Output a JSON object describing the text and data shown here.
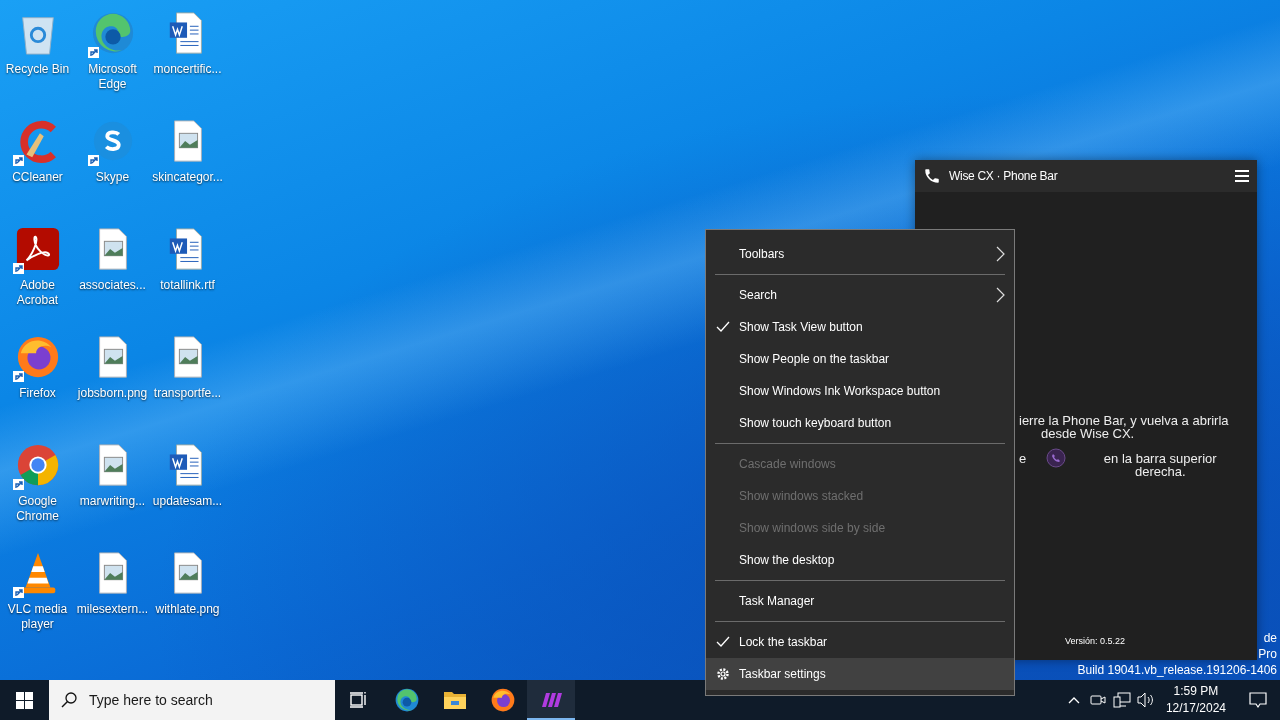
{
  "desktop": {
    "icons": [
      {
        "label": "Recycle Bin",
        "kind": "recycle",
        "shortcut": false
      },
      {
        "label": "CCleaner",
        "kind": "ccleaner",
        "shortcut": true
      },
      {
        "label": "Adobe Acrobat",
        "kind": "acrobat",
        "shortcut": true
      },
      {
        "label": "Firefox",
        "kind": "firefox",
        "shortcut": true
      },
      {
        "label": "Google Chrome",
        "kind": "chrome",
        "shortcut": true
      },
      {
        "label": "VLC media player",
        "kind": "vlc",
        "shortcut": true
      },
      {
        "label": "Microsoft Edge",
        "kind": "edge",
        "shortcut": true
      },
      {
        "label": "Skype",
        "kind": "skype",
        "shortcut": true
      },
      {
        "label": "associates...",
        "kind": "image",
        "shortcut": false
      },
      {
        "label": "jobsborn.png",
        "kind": "image",
        "shortcut": false
      },
      {
        "label": "marwriting...",
        "kind": "image",
        "shortcut": false
      },
      {
        "label": "milesextern...",
        "kind": "image",
        "shortcut": false
      },
      {
        "label": "moncertific...",
        "kind": "word",
        "shortcut": false
      },
      {
        "label": "skincategor...",
        "kind": "image",
        "shortcut": false
      },
      {
        "label": "totallink.rtf",
        "kind": "word",
        "shortcut": false
      },
      {
        "label": "transportfe...",
        "kind": "image",
        "shortcut": false
      },
      {
        "label": "updatesam...",
        "kind": "word",
        "shortcut": false
      },
      {
        "label": "withlate.png",
        "kind": "image",
        "shortcut": false
      }
    ],
    "os_watermark": [
      "de",
      "Pro",
      "Build 19041.vb_release.191206-1406"
    ]
  },
  "phone_bar": {
    "title": "Wise CX · Phone Bar",
    "line_1": "ierre la Phone Bar, y vuelva a abrirla",
    "line_2": "desde Wise CX.",
    "fragment": "e",
    "hint": "en la barra superior derecha.",
    "version": "Versión: 0.5.22"
  },
  "context_menu": {
    "groups": [
      [
        {
          "label": "Toolbars",
          "kind": "submenu",
          "disabled": false,
          "selected": false
        }
      ],
      [
        {
          "label": "Search",
          "kind": "submenu",
          "disabled": false,
          "selected": false
        },
        {
          "label": "Show Task View button",
          "kind": "toggle",
          "checked": true,
          "disabled": false,
          "selected": false
        },
        {
          "label": "Show People on the taskbar",
          "kind": "toggle",
          "checked": false,
          "disabled": false,
          "selected": false
        },
        {
          "label": "Show Windows Ink Workspace button",
          "kind": "toggle",
          "checked": false,
          "disabled": false,
          "selected": false
        },
        {
          "label": "Show touch keyboard button",
          "kind": "toggle",
          "checked": false,
          "disabled": false,
          "selected": false
        }
      ],
      [
        {
          "label": "Cascade windows",
          "kind": "action",
          "disabled": true,
          "selected": false
        },
        {
          "label": "Show windows stacked",
          "kind": "action",
          "disabled": true,
          "selected": false
        },
        {
          "label": "Show windows side by side",
          "kind": "action",
          "disabled": true,
          "selected": false
        },
        {
          "label": "Show the desktop",
          "kind": "action",
          "disabled": false,
          "selected": false
        }
      ],
      [
        {
          "label": "Task Manager",
          "kind": "action",
          "disabled": false,
          "selected": false
        }
      ],
      [
        {
          "label": "Lock the taskbar",
          "kind": "toggle",
          "checked": true,
          "disabled": false,
          "selected": false
        },
        {
          "label": "Taskbar settings",
          "kind": "settings",
          "disabled": false,
          "selected": true
        }
      ]
    ]
  },
  "taskbar": {
    "search": {
      "placeholder": "Type here to search"
    },
    "apps": [
      {
        "kind": "edge",
        "active": false
      },
      {
        "kind": "folder",
        "active": false
      },
      {
        "kind": "firefox",
        "active": false
      },
      {
        "kind": "phone",
        "active": true
      }
    ],
    "clock": {
      "time": "1:59 PM",
      "date": "12/17/2024"
    }
  }
}
